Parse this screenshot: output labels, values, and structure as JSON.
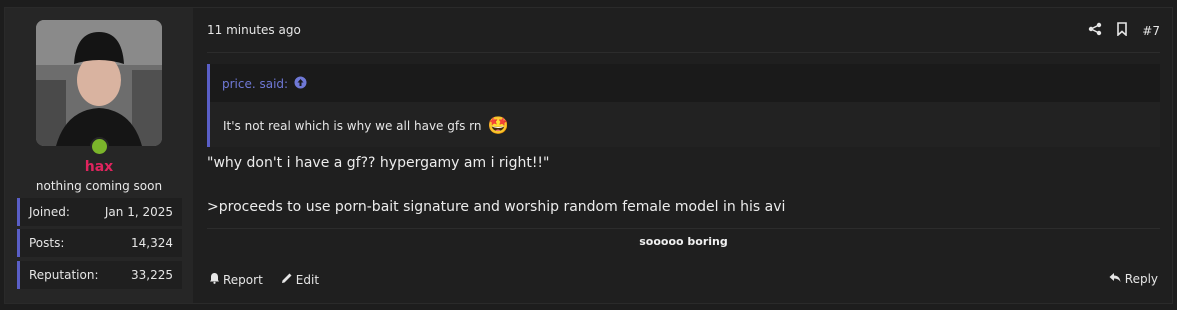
{
  "post": {
    "time": "11 minutes ago",
    "number": "#7",
    "message_line1": "\"why don't i have a gf?? hypergamy am i right!!\"",
    "message_line2": ">proceeds to use porn-bait signature and worship random female model in his avi",
    "signature": "sooooo boring"
  },
  "user": {
    "name": "hax",
    "title": "nothing coming soon",
    "stats": [
      {
        "label": "Joined:",
        "value": "Jan 1, 2025"
      },
      {
        "label": "Posts:",
        "value": "14,324"
      },
      {
        "label": "Reputation:",
        "value": "33,225"
      }
    ],
    "online_color": "#7bb52b",
    "name_color": "#e0245e"
  },
  "quote": {
    "author": "price. said:",
    "text": "It's not real which is why we all have gfs rn",
    "emoji": "🤩"
  },
  "footer": {
    "report": "Report",
    "edit": "Edit",
    "reply": "Reply"
  },
  "icons": {
    "share": "share-icon",
    "bookmark": "bookmark-icon",
    "quote_jump": "arrow-up-circle-icon",
    "report": "bell-icon",
    "edit": "pencil-icon",
    "reply": "reply-icon"
  },
  "colors": {
    "accent": "#5a5fc7",
    "background": "#1f1f1f"
  }
}
